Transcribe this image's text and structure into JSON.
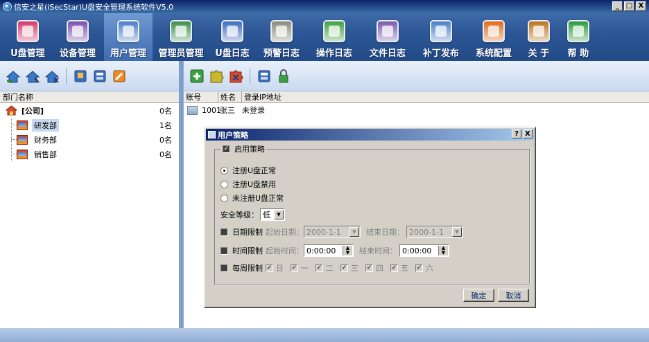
{
  "window": {
    "title": "信安之星(iSecStar)U盘安全管理系统软件V5.0",
    "min": "_",
    "max": "□",
    "close": "X"
  },
  "toolbar": [
    {
      "key": "udisk",
      "label": "U盘管理",
      "color": "#d23a6a"
    },
    {
      "key": "device",
      "label": "设备管理",
      "color": "#7a4fb0"
    },
    {
      "key": "user",
      "label": "用户管理",
      "color": "#4a7ec8"
    },
    {
      "key": "admin",
      "label": "管理员管理",
      "color": "#3d8f4a"
    },
    {
      "key": "ulog",
      "label": "U盘日志",
      "color": "#3d6dc0"
    },
    {
      "key": "alarm",
      "label": "预警日志",
      "color": "#8a8a7a"
    },
    {
      "key": "oplog",
      "label": "操作日志",
      "color": "#3fa040"
    },
    {
      "key": "filelog",
      "label": "文件日志",
      "color": "#7a5ab0"
    },
    {
      "key": "patch",
      "label": "补丁发布",
      "color": "#4a7ec8"
    },
    {
      "key": "config",
      "label": "系统配置",
      "color": "#e06a1a"
    },
    {
      "key": "about",
      "label": "关 于",
      "color": "#b8741c"
    },
    {
      "key": "help",
      "label": "帮 助",
      "color": "#2a9a3a"
    }
  ],
  "left": {
    "column": "部门名称",
    "root": {
      "name": "[公司]",
      "count": "0名"
    },
    "departments": [
      {
        "name": "研发部",
        "count": "1名"
      },
      {
        "name": "财务部",
        "count": "0名"
      },
      {
        "name": "销售部",
        "count": "0名"
      }
    ]
  },
  "right": {
    "columns": [
      "账号",
      "姓名",
      "登录IP地址"
    ],
    "rows": [
      {
        "account": "1001",
        "name": "张三",
        "ip": "未登录"
      }
    ]
  },
  "dialog": {
    "title": "用户策略",
    "help": "?",
    "close": "X",
    "enable": "启用策略",
    "radios": [
      "注册U盘正常",
      "注册U盘禁用",
      "未注册U盘正常"
    ],
    "security_label": "安全等级：",
    "security_value": "低",
    "date_limit": "日期限制",
    "start_date_label": "起始日期：",
    "start_date": "2000-1-1",
    "end_date_label": "结束日期：",
    "end_date": "2000-1-1",
    "time_limit": "时间限制",
    "start_time_label": "起始时间：",
    "start_time": "0:00:00",
    "end_time_label": "结束时间：",
    "end_time": "0:00:00",
    "week_limit": "每周限制",
    "weekdays": [
      "日",
      "一",
      "二",
      "三",
      "四",
      "五",
      "六"
    ],
    "ok": "确定",
    "cancel": "取消"
  }
}
